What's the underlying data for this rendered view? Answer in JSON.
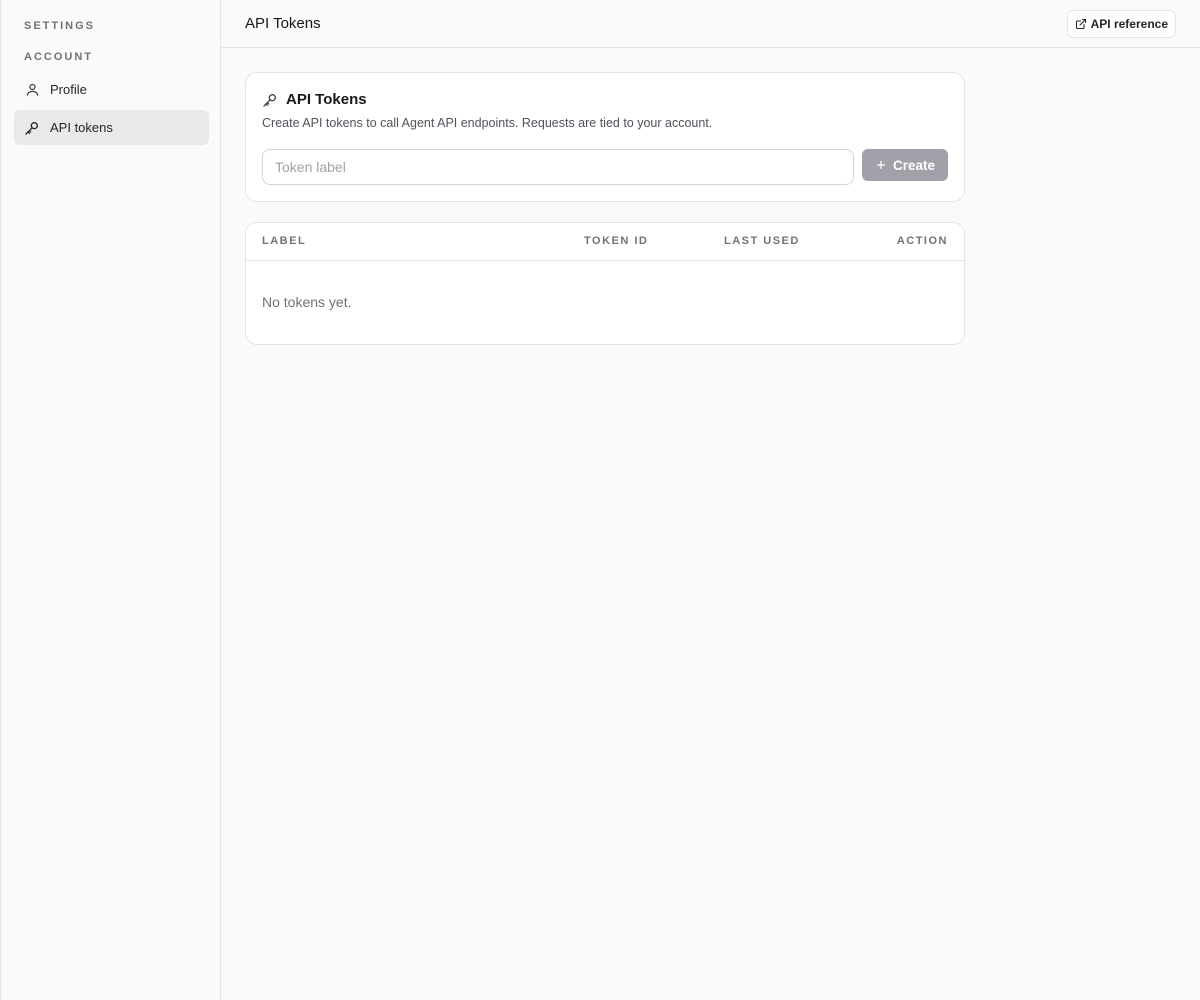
{
  "sidebar": {
    "settings_label": "SETTINGS",
    "account_label": "ACCOUNT",
    "items": [
      {
        "label": "Profile",
        "icon": "user-icon",
        "active": false
      },
      {
        "label": "API tokens",
        "icon": "key-icon",
        "active": true
      }
    ]
  },
  "header": {
    "title": "API Tokens",
    "api_reference_label": "API reference",
    "api_reference_icon": "external-link-icon"
  },
  "create_card": {
    "title": "API Tokens",
    "title_icon": "key-icon",
    "description": "Create API tokens to call Agent API endpoints. Requests are tied to your account.",
    "input_placeholder": "Token label",
    "input_value": "",
    "create_label": "Create",
    "create_icon": "plus-icon"
  },
  "tokens_table": {
    "columns": [
      "LABEL",
      "TOKEN ID",
      "LAST USED",
      "ACTION"
    ],
    "rows": [],
    "empty_text": "No tokens yet."
  },
  "colors": {
    "active_nav_bg": "#e9e9ec",
    "disabled_button": "#a1a1aa",
    "border": "#e4e4e7"
  }
}
